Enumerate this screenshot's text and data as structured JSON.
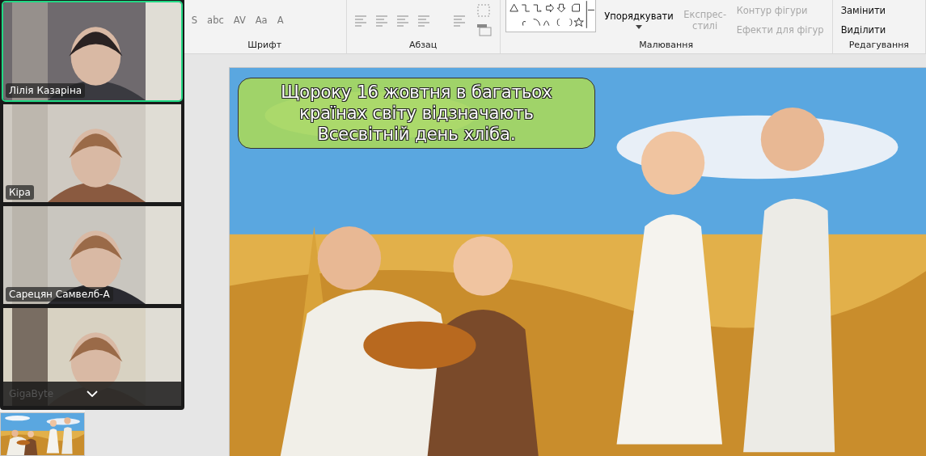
{
  "ribbon": {
    "groups": [
      {
        "label": "Шрифт",
        "kind": "font",
        "glyphs": [
          "S",
          "abc",
          "AV",
          "Aa",
          "A"
        ]
      },
      {
        "label": "Абзац",
        "kind": "paragraph"
      },
      {
        "label": "Малювання",
        "kind": "drawing",
        "arrange": "Упорядкувати",
        "styles": {
          "label": "Експрес-стилі",
          "disabled": true
        },
        "commands": [
          {
            "label": "Контур фігури",
            "disabled": true
          },
          {
            "label": "Ефекти для фігур",
            "disabled": true
          }
        ]
      },
      {
        "label": "Редагування",
        "kind": "editing",
        "commands": [
          {
            "label": "Замінити",
            "disabled": false
          },
          {
            "label": "Виділити",
            "disabled": false
          }
        ]
      }
    ]
  },
  "slide": {
    "caption_lines": [
      "Щороку 16 жовтня в багатьох",
      "країнах світу відзначають",
      "Всесвітній день хліба."
    ]
  },
  "video_panel": {
    "tiles": [
      {
        "name": "Лілія Казаріна",
        "selected": true
      },
      {
        "name": "Кіра",
        "selected": false
      },
      {
        "name": "Сарецян Самвелб-А",
        "selected": false
      },
      {
        "name": "GigaByte",
        "selected": false
      }
    ]
  }
}
